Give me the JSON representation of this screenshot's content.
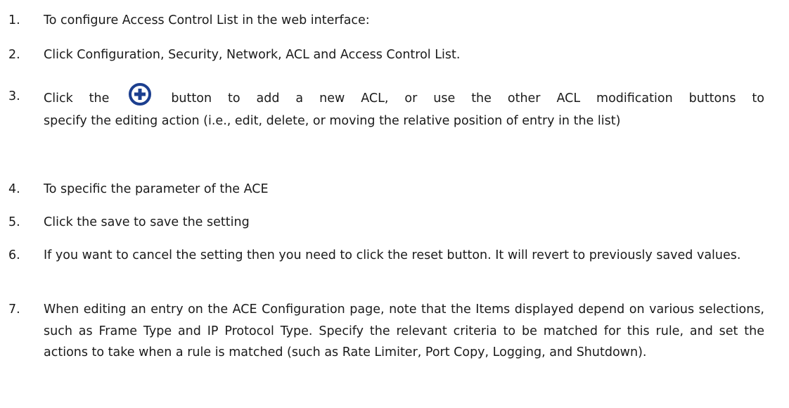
{
  "steps": [
    {
      "number": "1.",
      "text": "To configure Access Control List in the web interface:"
    },
    {
      "number": "2.",
      "text": "Click Configuration, Security, Network, ACL and Access Control List."
    },
    {
      "number": "3.",
      "text_before_icon": "Click the",
      "icon": "add-circle-icon",
      "text_after_icon": "button to add a new ACL, or use the other ACL modification buttons to",
      "text_rest": "specify the editing action (i.e., edit, delete, or moving the relative position of entry in the list)"
    },
    {
      "number": "4.",
      "text": "To specific the parameter of the ACE"
    },
    {
      "number": "5.",
      "text": "Click the save to save the setting"
    },
    {
      "number": "6.",
      "text": "If you want to cancel the setting then you need to click the reset button. It will revert to previously saved values."
    },
    {
      "number": "7.",
      "text": "When editing an entry on the ACE Configuration page, note that the Items displayed depend on various selections, such as Frame Type and IP Protocol Type. Specify the relevant criteria to be matched for this rule, and set the actions to take when a rule is matched (such as Rate Limiter, Port Copy, Logging, and Shutdown)."
    }
  ],
  "colors": {
    "text": "#1a1a1a",
    "icon_fill": "#1c3f8f"
  }
}
